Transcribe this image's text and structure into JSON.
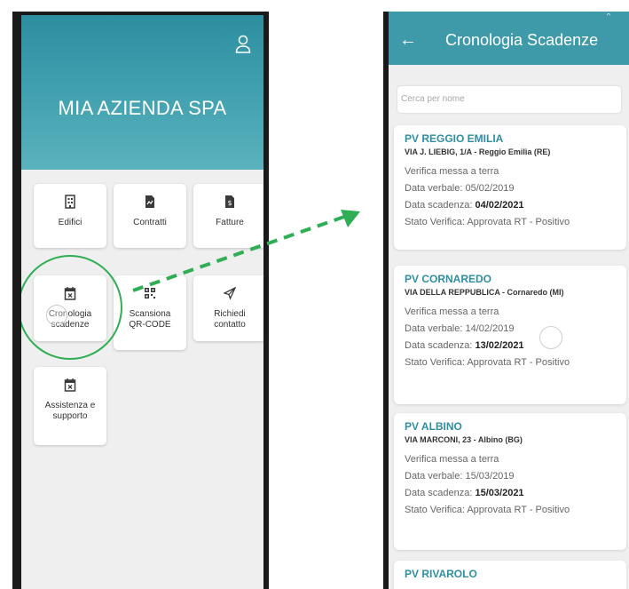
{
  "left_app": {
    "company_title": "MIA AZIENDA SPA",
    "menu": [
      {
        "label": "Edifici",
        "icon": "building-icon"
      },
      {
        "label": "Contratti",
        "icon": "document-icon"
      },
      {
        "label": "Fatture",
        "icon": "invoice-icon"
      },
      {
        "label": "Cronologia scadenze",
        "icon": "calendar-icon"
      },
      {
        "label": "Scansiona QR-CODE",
        "icon": "qr-code-icon"
      },
      {
        "label": "Richiedi contatto",
        "icon": "send-icon"
      },
      {
        "label": "Assistenza e supporto",
        "icon": "calendar-icon"
      }
    ]
  },
  "right_app": {
    "title": "Cronologia Scadenze",
    "back_icon": "arrow-left-icon",
    "status_glyph": "ᵔ",
    "search_placeholder": "Cerca per nome",
    "records": [
      {
        "name": "PV REGGIO EMILIA",
        "address": "VIA J. LIEBIG, 1/A - Reggio Emilia (RE)",
        "verifica": "Verifica  messa a terra",
        "data_verbale": "Data verbale: 05/02/2019",
        "data_scadenza_label": "Data scadenza: ",
        "data_scadenza": "04/02/2021",
        "stato": "Stato Verifica: Approvata RT - Positivo"
      },
      {
        "name": "PV CORNAREDO",
        "address": "VIA DELLA REPPUBLICA - Cornaredo (MI)",
        "verifica": "Verifica  messa a terra",
        "data_verbale": "Data verbale: 14/02/2019",
        "data_scadenza_label": "Data scadenza: ",
        "data_scadenza": "13/02/2021",
        "stato": "Stato Verifica: Approvata RT - Positivo"
      },
      {
        "name": "PV ALBINO",
        "address": "VIA MARCONI, 23  - Albino (BG)",
        "verifica": "Verifica  messa a terra",
        "data_verbale": "Data verbale: 15/03/2019",
        "data_scadenza_label": "Data scadenza: ",
        "data_scadenza": "15/03/2021",
        "stato": "Stato Verifica: Approvata RT - Positivo"
      },
      {
        "name": "PV RIVAROLO"
      }
    ]
  },
  "colors": {
    "header_teal": "#3e9aa9",
    "accent_text": "#2f8ea3",
    "arrow_green": "#2fae55"
  }
}
